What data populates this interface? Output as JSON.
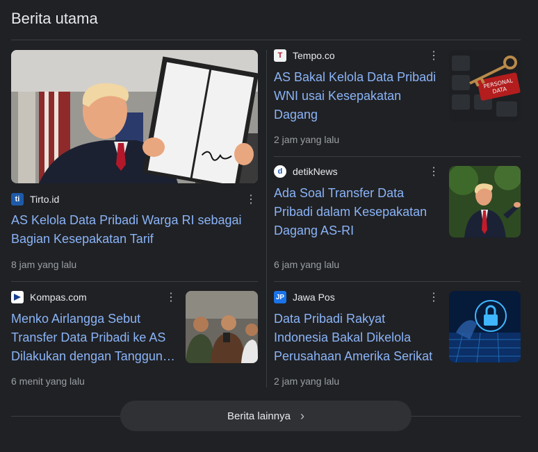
{
  "section_title": "Berita utama",
  "cards": [
    {
      "source": "Tirto.id",
      "favicon": "ti",
      "headline": "AS Kelola Data Pribadi Warga RI sebagai Bagian Kesepakatan Tarif",
      "time": "8 jam yang lalu",
      "image": "trump-signing-document"
    },
    {
      "source": "Tempo.co",
      "favicon": "T",
      "headline": "AS Bakal Kelola Data Pribadi WNI usai Kesepakatan Dagang",
      "time": "2 jam yang lalu",
      "image": "key-on-keyboard",
      "image_text": "PERSONAL DATA"
    },
    {
      "source": "detikNews",
      "favicon": "d",
      "headline": "Ada Soal Transfer Data Pribadi dalam Kesepakatan Dagang AS-RI",
      "time": "6 jam yang lalu",
      "image": "trump-pointing"
    },
    {
      "source": "Kompas.com",
      "favicon": "K",
      "headline": "Menko Airlangga Sebut Transfer Data Pribadi ke AS Dilakukan dengan Tanggung Jawab",
      "time": "6 menit yang lalu",
      "image": "press-conference"
    },
    {
      "source": "Jawa Pos",
      "favicon": "JP",
      "headline": "Data Pribadi Rakyat Indonesia Bakal Dikelola Perusahaan Amerika Serikat",
      "time": "2 jam yang lalu",
      "image": "cyber-lock"
    }
  ],
  "more_button": "Berita lainnya",
  "colors": {
    "background": "#202124",
    "link": "#8ab4f8",
    "muted": "#9aa0a6",
    "divider": "#3c4043"
  }
}
